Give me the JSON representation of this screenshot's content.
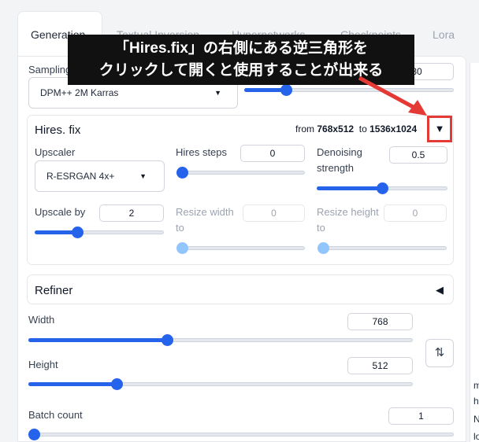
{
  "tabs": [
    "Generation",
    "Textual Inversion",
    "Hypernetworks",
    "Checkpoints",
    "Lora"
  ],
  "sampling": {
    "label": "Sampling method",
    "value": "DPM++ 2M Karras",
    "steps_value": "30",
    "steps_fraction": 0.2
  },
  "hires": {
    "title": "Hires. fix",
    "from_label": "from",
    "from_value": "768x512",
    "to_label": "to",
    "to_value": "1536x1024",
    "toggle_glyph": "▼",
    "upscaler": {
      "label": "Upscaler",
      "value": "R-ESRGAN 4x+"
    },
    "hires_steps": {
      "label": "Hires steps",
      "value": "0",
      "fraction": 0
    },
    "denoising": {
      "label_line1": "Denoising",
      "label_line2": "strength",
      "value": "0.5",
      "fraction": 0.5
    },
    "upscale_by": {
      "label": "Upscale by",
      "value": "2",
      "fraction": 0.33
    },
    "resize_width": {
      "label_line1": "Resize width",
      "label_line2": "to",
      "value": "0",
      "fraction": 0
    },
    "resize_height": {
      "label_line1": "Resize height",
      "label_line2": "to",
      "value": "0",
      "fraction": 0
    }
  },
  "refiner": {
    "title": "Refiner",
    "toggle_glyph": "◀"
  },
  "width": {
    "label": "Width",
    "value": "768",
    "fraction": 0.36
  },
  "height": {
    "label": "Height",
    "value": "512",
    "fraction": 0.23
  },
  "swap_glyph": "⇅",
  "batch_count": {
    "label": "Batch count",
    "value": "1",
    "fraction": 0
  },
  "right_fragments": [
    "m",
    "h",
    "N",
    "lo"
  ],
  "callout": {
    "line1": "「Hires.fix」の右側にある逆三角形を",
    "line2": "クリックして開くと使用することが出来る"
  },
  "colors": {
    "accent": "#2563eb",
    "highlight": "#e53935"
  }
}
